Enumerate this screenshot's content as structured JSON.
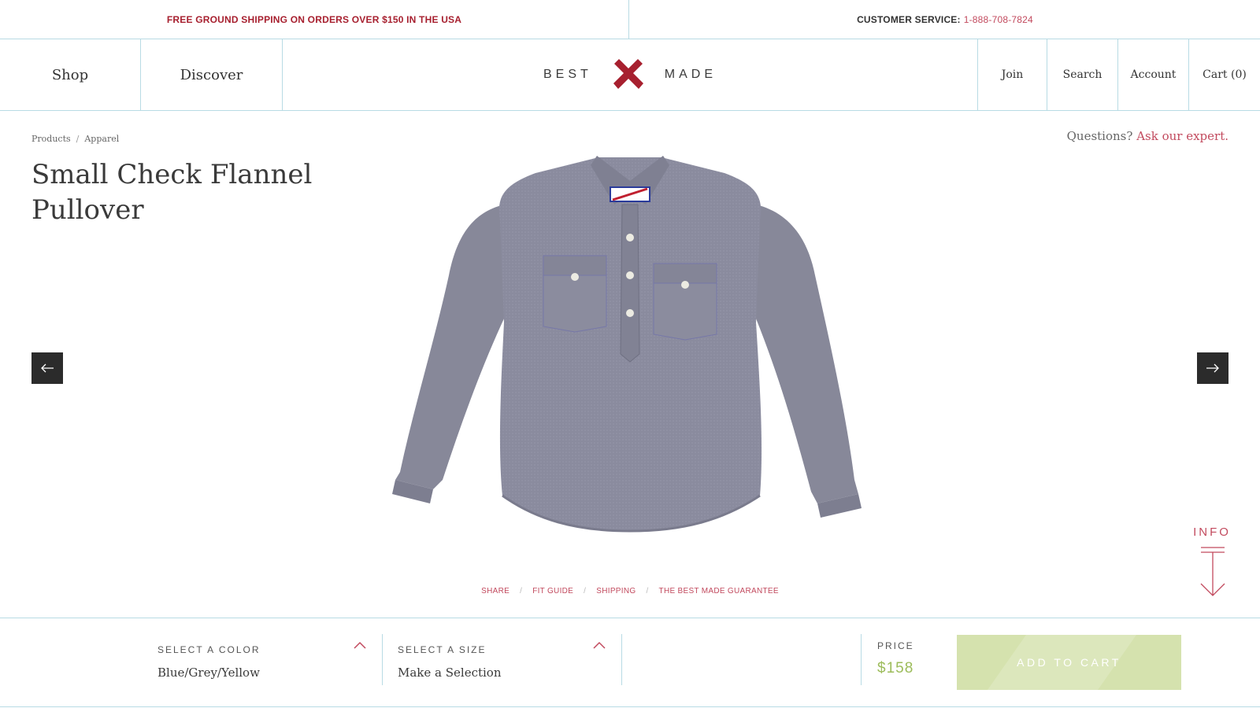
{
  "topbar": {
    "promo": "FREE GROUND SHIPPING ON ORDERS OVER $150 IN THE USA",
    "customer_service_label": "CUSTOMER SERVICE:",
    "phone": "1-888-708-7824"
  },
  "nav": {
    "shop": "Shop",
    "discover": "Discover",
    "logo_left": "BEST",
    "logo_right": "MADE",
    "join": "Join",
    "search": "Search",
    "account": "Account",
    "cart": "Cart (0)"
  },
  "breadcrumb": {
    "items": [
      "Products",
      "Apparel"
    ],
    "separator": "/"
  },
  "product": {
    "title_line1": "Small Check Flannel",
    "title_line2": "Pullover",
    "image_alt": "grey-blue flannel pullover shirt"
  },
  "questions": {
    "prefix": "Questions?",
    "link": "Ask our expert."
  },
  "carousel": {
    "prev_icon": "arrow-left-icon",
    "next_icon": "arrow-right-icon"
  },
  "info": {
    "label": "INFO",
    "icon": "arrow-down-icon"
  },
  "links": {
    "share": "SHARE",
    "fit_guide": "FIT GUIDE",
    "shipping": "SHIPPING",
    "guarantee": "THE BEST MADE GUARANTEE",
    "separator": "/"
  },
  "purchase": {
    "color_label": "SELECT A COLOR",
    "color_value": "Blue/Grey/Yellow",
    "size_label": "SELECT A SIZE",
    "size_value": "Make a Selection",
    "price_label": "PRICE",
    "price_value": "$158",
    "add_to_cart": "ADD TO CART"
  },
  "colors": {
    "accent_red": "#c24a5e",
    "brand_red": "#a7202f",
    "border_blue": "#b8dbe4",
    "price_green": "#9cbc5a",
    "button_green": "#d5e2ae"
  }
}
